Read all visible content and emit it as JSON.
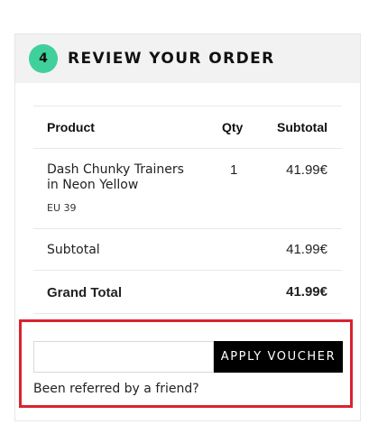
{
  "step": {
    "number": "4",
    "title": "REVIEW YOUR ORDER"
  },
  "table": {
    "headers": {
      "product": "Product",
      "qty": "Qty",
      "subtotal": "Subtotal"
    },
    "items": [
      {
        "name_line1": "Dash Chunky Trainers",
        "name_line2": "in Neon Yellow",
        "size": "EU 39",
        "qty": "1",
        "subtotal": "41.99€"
      }
    ]
  },
  "totals": {
    "subtotal_label": "Subtotal",
    "subtotal_value": "41.99€",
    "grand_total_label": "Grand Total",
    "grand_total_value": "41.99€"
  },
  "voucher": {
    "input_value": "",
    "placeholder": "",
    "apply_label": "APPLY VOUCHER",
    "referral_text": "Been referred by a friend?"
  },
  "colors": {
    "step_badge": "#3fd09b",
    "header_bg": "#f2f2f2",
    "button_bg": "#000000",
    "highlight_border": "#d9232e"
  }
}
